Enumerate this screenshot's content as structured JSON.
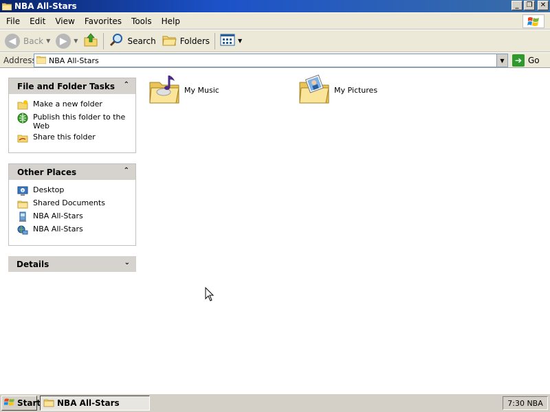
{
  "window": {
    "title": "NBA All-Stars",
    "icons": {
      "app": "folder-icon",
      "minimize": "minimize-icon",
      "restore": "restore-icon",
      "close": "close-icon"
    }
  },
  "menubar": {
    "items": [
      "File",
      "Edit",
      "View",
      "Favorites",
      "Tools",
      "Help"
    ],
    "logo": "windows-logo-icon"
  },
  "toolbar": {
    "back_label": "Back",
    "search_label": "Search",
    "folders_label": "Folders",
    "icons": {
      "back": "back-arrow-icon",
      "forward": "forward-arrow-icon",
      "up": "up-folder-icon",
      "search": "search-icon",
      "folders": "folders-icon",
      "views": "views-icon"
    }
  },
  "address": {
    "label": "Address",
    "value": "NBA All-Stars",
    "go_label": "Go"
  },
  "taskpane": {
    "file_tasks": {
      "title": "File and Folder Tasks",
      "items": [
        "Make a new folder",
        "Publish this folder to the Web",
        "Share this folder"
      ]
    },
    "other_places": {
      "title": "Other Places",
      "items": [
        "Desktop",
        "Shared Documents",
        "NBA All-Stars",
        "NBA All-Stars"
      ]
    },
    "details": {
      "title": "Details"
    }
  },
  "content": {
    "items": [
      {
        "label": "My Music",
        "icon": "music-folder-icon"
      },
      {
        "label": "My Pictures",
        "icon": "pictures-folder-icon"
      }
    ]
  },
  "taskbar": {
    "start_label": "Start",
    "task_label": "NBA All-Stars",
    "tray_text": "7:30 NBA"
  },
  "colors": {
    "titlebar_start": "#0a246a",
    "titlebar_end": "#3a6ea5",
    "chrome": "#ece9d8",
    "panel_head": "#d6d3ce",
    "taskbar": "#d4d0c8"
  }
}
